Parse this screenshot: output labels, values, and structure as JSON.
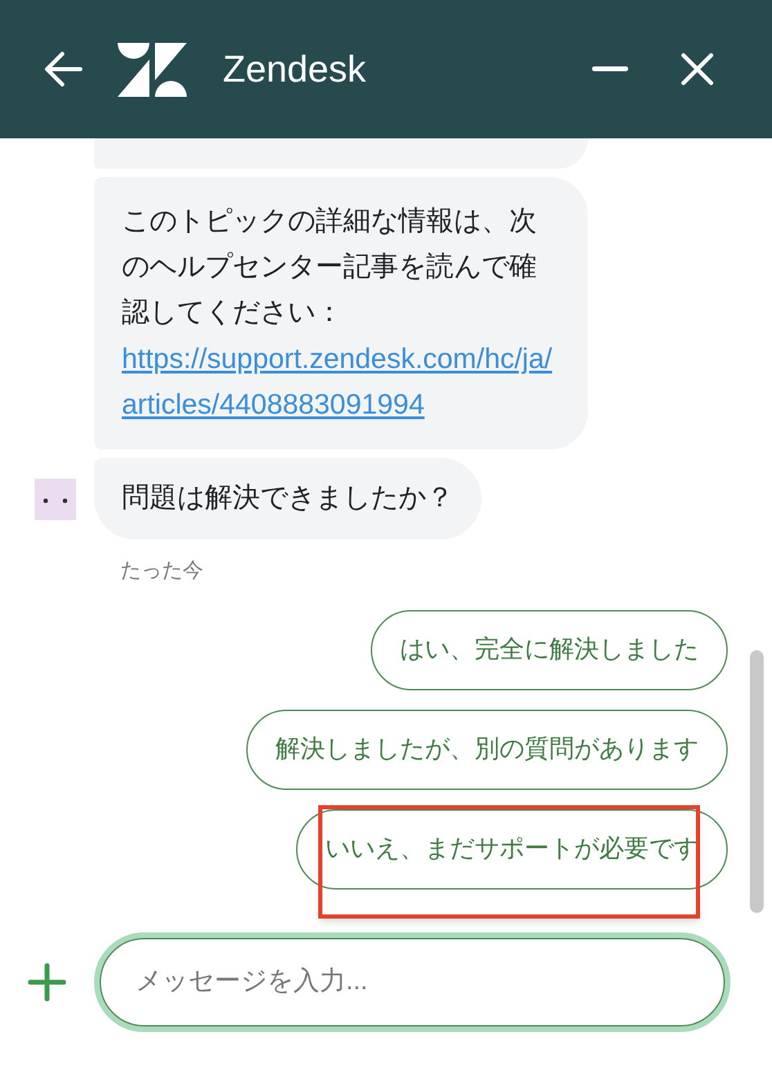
{
  "header": {
    "title": "Zendesk"
  },
  "messages": [
    {
      "text": "このトピックの詳細な情報は、次のヘルプセンター記事を読んで確認してください：",
      "link": "https://support.zendesk.com/hc/ja/articles/4408883091994",
      "avatar": false
    },
    {
      "text": "問題は解決できましたか？",
      "avatar": true
    }
  ],
  "timestamp": "たった今",
  "quick_replies": [
    {
      "label": "はい、完全に解決しました",
      "highlighted": false
    },
    {
      "label": "解決しましたが、別の質問があります",
      "highlighted": false
    },
    {
      "label": "いいえ、まだサポートが必要です",
      "highlighted": true
    }
  ],
  "composer": {
    "placeholder": "メッセージを入力..."
  }
}
